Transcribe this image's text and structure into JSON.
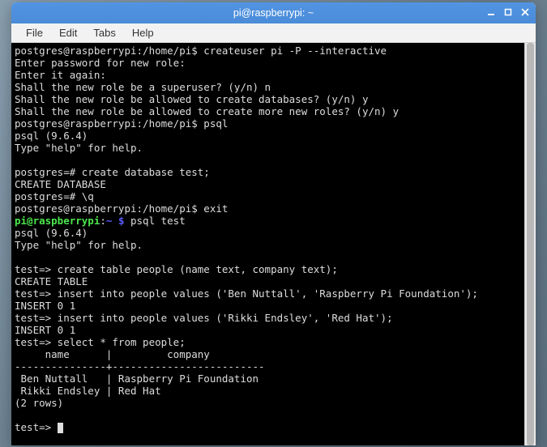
{
  "titlebar": {
    "title": "pi@raspberrypi: ~"
  },
  "menubar": {
    "file": "File",
    "edit": "Edit",
    "tabs": "Tabs",
    "help": "Help"
  },
  "terminal": {
    "l1_prompt": "postgres@raspberrypi:/home/pi$ ",
    "l1_cmd": "createuser pi -P --interactive",
    "l2": "Enter password for new role:",
    "l3": "Enter it again:",
    "l4": "Shall the new role be a superuser? (y/n) n",
    "l5": "Shall the new role be allowed to create databases? (y/n) y",
    "l6": "Shall the new role be allowed to create more new roles? (y/n) y",
    "l7_prompt": "postgres@raspberrypi:/home/pi$ ",
    "l7_cmd": "psql",
    "l8": "psql (9.6.4)",
    "l9": "Type \"help\" for help.",
    "l10": "",
    "l11": "postgres=# create database test;",
    "l12": "CREATE DATABASE",
    "l13": "postgres=# \\q",
    "l14_prompt": "postgres@raspberrypi:/home/pi$ ",
    "l14_cmd": "exit",
    "l15_user": "pi@raspberrypi",
    "l15_colon": ":",
    "l15_path": "~ $",
    "l15_cmd": " psql test",
    "l16": "psql (9.6.4)",
    "l17": "Type \"help\" for help.",
    "l18": "",
    "l19": "test=> create table people (name text, company text);",
    "l20": "CREATE TABLE",
    "l21": "test=> insert into people values ('Ben Nuttall', 'Raspberry Pi Foundation');",
    "l22": "INSERT 0 1",
    "l23": "test=> insert into people values ('Rikki Endsley', 'Red Hat');",
    "l24": "INSERT 0 1",
    "l25": "test=> select * from people;",
    "l26": "     name      |         company",
    "l27": "---------------+-------------------------",
    "l28": " Ben Nuttall   | Raspberry Pi Foundation",
    "l29": " Rikki Endsley | Red Hat",
    "l30": "(2 rows)",
    "l31": "",
    "l32": "test=> "
  }
}
